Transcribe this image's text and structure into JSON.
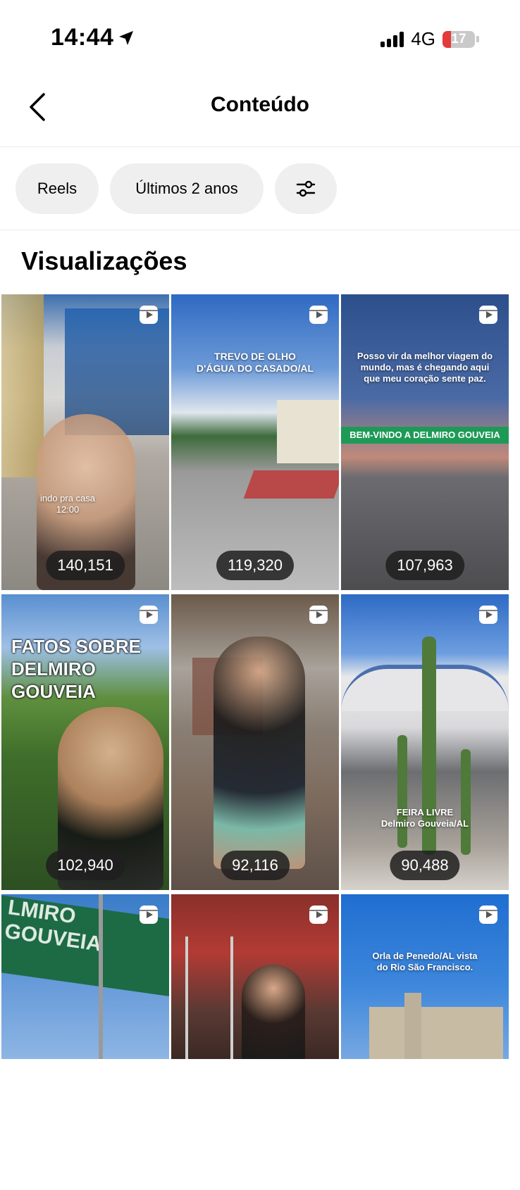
{
  "status_bar": {
    "time": "14:44",
    "network": "4G",
    "battery": "17"
  },
  "header": {
    "title": "Conteúdo"
  },
  "filters": {
    "type_label": "Reels",
    "period_label": "Últimos 2 anos"
  },
  "section": {
    "title": "Visualizações"
  },
  "tiles": [
    {
      "views": "140,151",
      "overlay": "indo pra casa\n12:00"
    },
    {
      "views": "119,320",
      "overlay": "TREVO DE OLHO\nD'ÁGUA DO CASADO/AL"
    },
    {
      "views": "107,963",
      "overlay": "Posso vir da melhor viagem do\nmundo, mas é chegando aqui\nque meu coração sente paz."
    },
    {
      "views": "102,940",
      "overlay": "FATOS SOBRE\nDELMIRO\nGOUVEIA"
    },
    {
      "views": "92,116",
      "overlay": ""
    },
    {
      "views": "90,488",
      "overlay": "FEIRA LIVRE\nDelmiro Gouveia/AL"
    },
    {
      "views": "",
      "overlay": ""
    },
    {
      "views": "",
      "overlay": ""
    },
    {
      "views": "",
      "overlay": "Orla de Penedo/AL vista\ndo Rio São Francisco."
    }
  ]
}
